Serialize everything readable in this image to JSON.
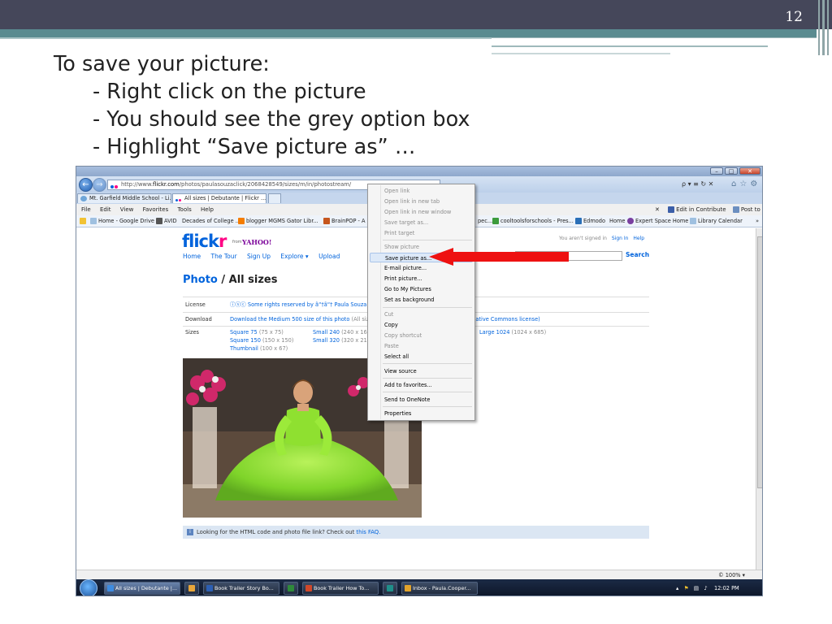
{
  "slide": {
    "number": "12",
    "lines": [
      "To save your picture:",
      "- Right click on the picture",
      "- You should see the grey option box",
      "- Highlight “Save picture as” …"
    ]
  },
  "browser": {
    "address": {
      "prefix": "http://www.",
      "domain": "flickr.com",
      "path": "/photos/paulasouzaclick/2068428549/sizes/m/in/photostream/"
    },
    "address_tools": "ρ ▾ ≡ ↻ ✕",
    "tabs": [
      "Mt. Garfield Middle School - Li...",
      "All sizes | Debutante | Flickr ... ✕"
    ],
    "menu": [
      "File",
      "Edit",
      "View",
      "Favorites",
      "Tools",
      "Help"
    ],
    "menu_right": {
      "close": "✕",
      "edit_in_contribute": "Edit in Contribute",
      "post_to_blog": "Post to Blo"
    },
    "favorites_left": [
      "Home - Google Drive",
      "AVID",
      "Decades of College ...",
      "blogger MGMS Gator Libr...",
      "BrainPOP - A"
    ],
    "favorites_right": [
      "pec...",
      "cooltoolsforschools - Pres...",
      "Edmodo",
      "Home",
      "Expert Space Home",
      "Library Calendar"
    ],
    "favorites_more": "»",
    "zoom": "© 100%  ▾"
  },
  "flickr": {
    "logo": "flick",
    "logo_r": "r",
    "from": "from",
    "yahoo": "YAHOO!",
    "nav": [
      "Home",
      "The Tour",
      "Sign Up",
      "Explore  ▾",
      "Upload"
    ],
    "signin_text": "You aren't signed in",
    "signin_link": "Sign In",
    "help_link": "Help",
    "search_label": "Search",
    "title_photo": "Photo",
    "title_rest": " / All sizes",
    "license_label": "License",
    "license_value": "ⓘⓢⓒ Some rights reserved by ã“†ã“† Paula Souza",
    "download_label": "Download",
    "download_value": "Download the Medium 500 size of this photo",
    "download_note": "(All sizes",
    "download_right": "a Creative Commons license)",
    "sizes_label": "Sizes",
    "sizes": {
      "sq75": "Square 75",
      "sq75_d": "(75 x 75)",
      "sq150": "Square 150",
      "sq150_d": "(150 x 150)",
      "thumb": "Thumbnail",
      "thumb_d": "(100 x 67)",
      "s240": "Small 240",
      "s240_d": "(240 x 161)",
      "s320": "Small 320",
      "s320_d": "(320 x 214)",
      "l1024": "Large 1024",
      "l1024_d": "(1024 x 685)"
    },
    "faq_text": "Looking for the HTML code and photo file link? Check out ",
    "faq_link": "this FAQ."
  },
  "context_menu": [
    {
      "label": "Open link",
      "disabled": true
    },
    {
      "label": "Open link in new tab",
      "disabled": true
    },
    {
      "label": "Open link in new window",
      "disabled": true
    },
    {
      "label": "Save target as...",
      "disabled": true
    },
    {
      "label": "Print target",
      "disabled": true
    },
    {
      "label": "Show picture",
      "disabled": true
    },
    {
      "label": "Save picture as...",
      "highlighted": true
    },
    {
      "label": "E-mail picture..."
    },
    {
      "label": "Print picture..."
    },
    {
      "label": "Go to My Pictures"
    },
    {
      "label": "Set as background"
    },
    {
      "label": "Cut",
      "disabled": true
    },
    {
      "label": "Copy"
    },
    {
      "label": "Copy shortcut",
      "disabled": true
    },
    {
      "label": "Paste",
      "disabled": true
    },
    {
      "label": "Select all"
    },
    {
      "label": "View source"
    },
    {
      "label": "Add to favorites..."
    },
    {
      "label": "Send to OneNote"
    },
    {
      "label": "Properties"
    }
  ],
  "taskbar": {
    "items": [
      "All sizes | Debutante |...",
      "",
      "Book Trailer Story Bo...",
      "",
      "Book Trailer How To...",
      "",
      "Inbox - Paula.Cooper..."
    ],
    "clock": "12:02 PM"
  },
  "colors": {
    "header_dark": "#45475a",
    "header_teal": "#5a8b90",
    "flickr_blue": "#0063dc",
    "flickr_pink": "#ff0084",
    "arrow_red": "#ee1111"
  }
}
